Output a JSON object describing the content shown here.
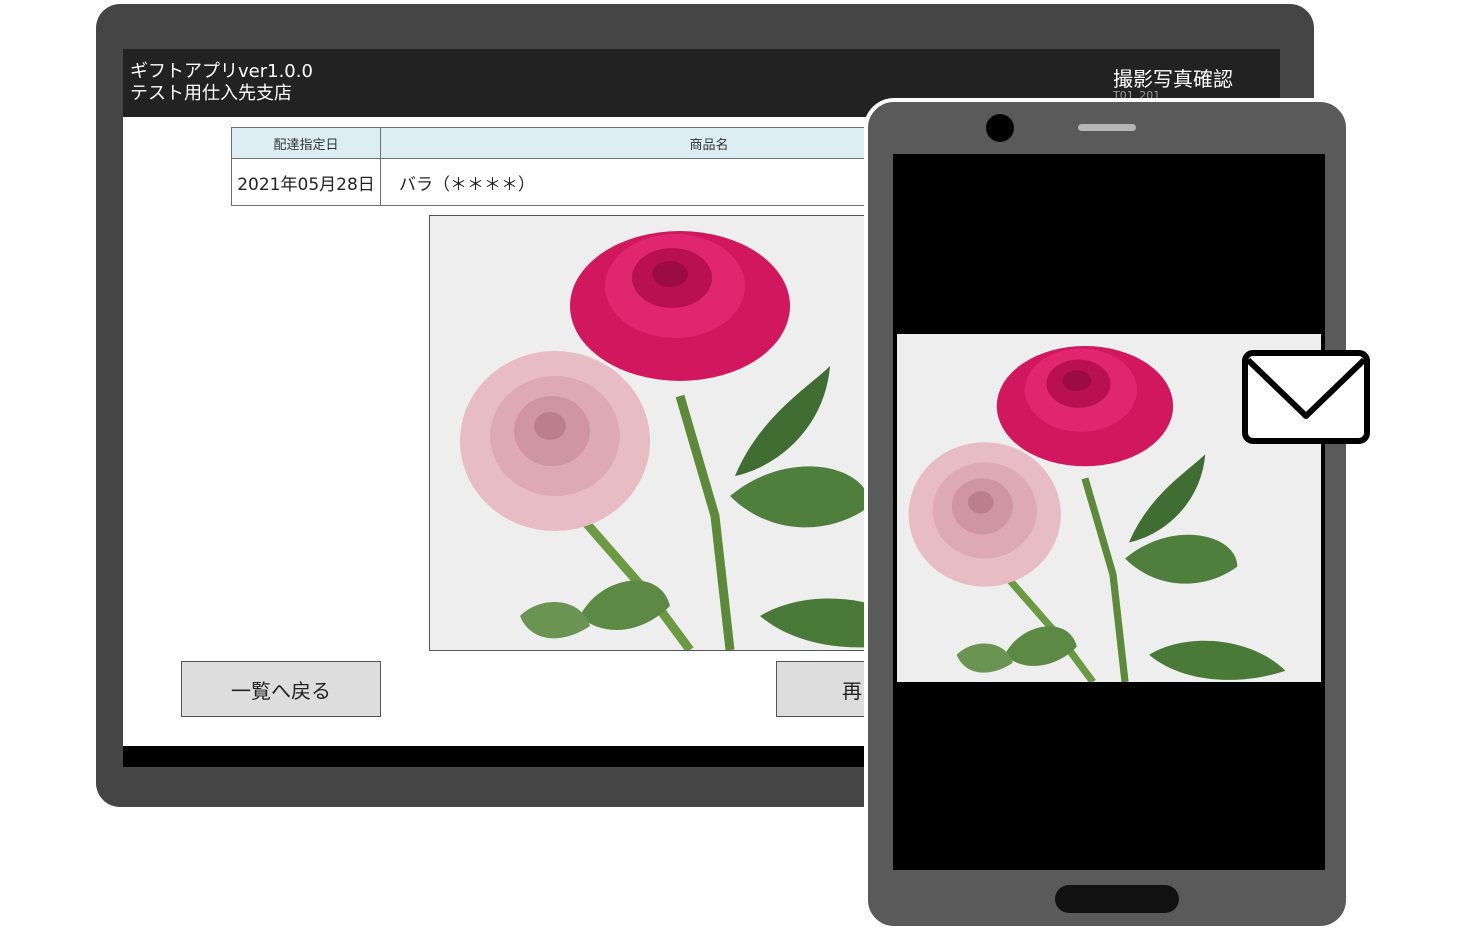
{
  "app": {
    "title": "ギフトアプリver1.0.0",
    "store": "テスト用仕入先支店",
    "screen_title": "撮影写真確認",
    "screen_code": "T01_201"
  },
  "table": {
    "headers": [
      "配達指定日",
      "商品名"
    ],
    "rows": [
      [
        "2021年05月28日",
        "バラ（＊＊＊＊）"
      ]
    ]
  },
  "buttons": {
    "back": "一覧へ戻る",
    "retake": "再"
  },
  "icons": [
    "rose-photo",
    "mail-icon",
    "camera",
    "speaker",
    "home-button"
  ],
  "colors": {
    "header_bg": "#222222",
    "table_header_bg": "#dcedf3",
    "button_bg": "#dddddd",
    "device_frame": "#454545"
  }
}
